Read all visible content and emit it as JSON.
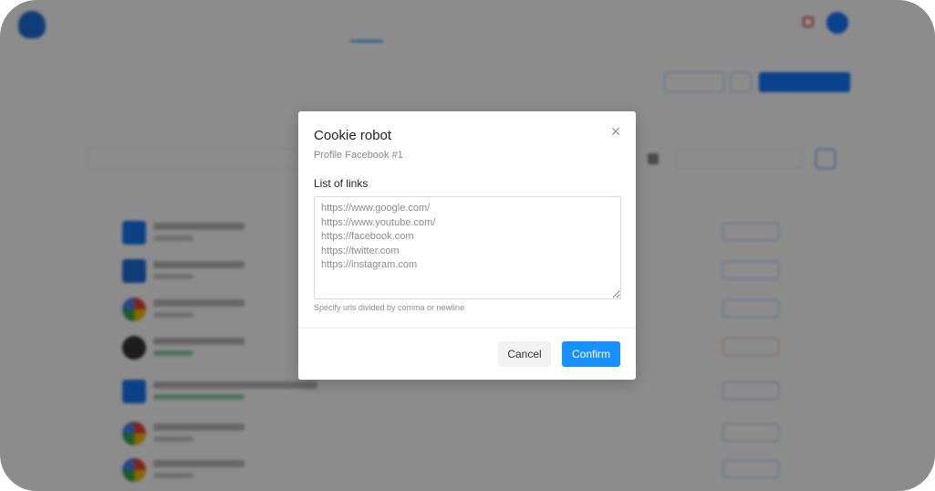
{
  "modal": {
    "title": "Cookie robot",
    "subtitle": "Profile Facebook #1",
    "close_icon": "close-icon",
    "field_label": "List of links",
    "links_value": "https://www.google.com/\nhttps://www.youtube.com/\nhttps://facebook.com\nhttps://twitter.com\nhttps://instagram.com",
    "help_text": "Specify urls divided by comma or newline",
    "cancel_label": "Cancel",
    "confirm_label": "Confirm"
  },
  "colors": {
    "primary": "#1890ff",
    "overlay": "rgba(0,0,0,0.45)"
  }
}
